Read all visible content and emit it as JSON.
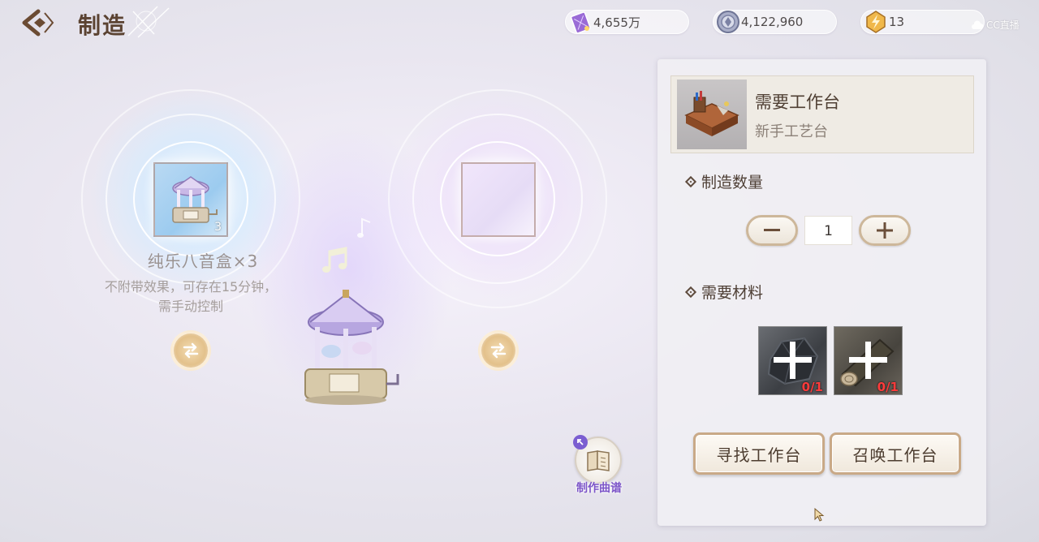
{
  "header": {
    "title": "制造",
    "back_icon": "back-arrow-icon"
  },
  "currencies": [
    {
      "icon": "crystal-card-icon",
      "value": "4,655万"
    },
    {
      "icon": "silver-coin-icon",
      "value": "4,122,960"
    },
    {
      "icon": "energy-icon",
      "value": "13"
    }
  ],
  "watermark": "CC直播",
  "craft": {
    "left_slot": {
      "item": "music-box-icon",
      "count": "3"
    },
    "item_name": "纯乐八音盒×3",
    "item_desc_line1": "不附带效果，可存在15分钟，",
    "item_desc_line2": "需手动控制",
    "recipe_label": "制作曲谱"
  },
  "panel": {
    "workbench_title": "需要工作台",
    "workbench_name": "新手工艺台",
    "quantity_title": "制造数量",
    "quantity_value": "1",
    "materials_title": "需要材料",
    "materials": [
      {
        "icon": "ore-material-icon",
        "count": "0/1"
      },
      {
        "icon": "wood-material-icon",
        "count": "0/1"
      }
    ],
    "find_button": "寻找工作台",
    "summon_button": "召唤工作台"
  },
  "colors": {
    "title": "#5b4332",
    "accent_gold": "#c9a987",
    "recipe_purple": "#7c55c8",
    "missing_red": "#ff3b3b"
  }
}
